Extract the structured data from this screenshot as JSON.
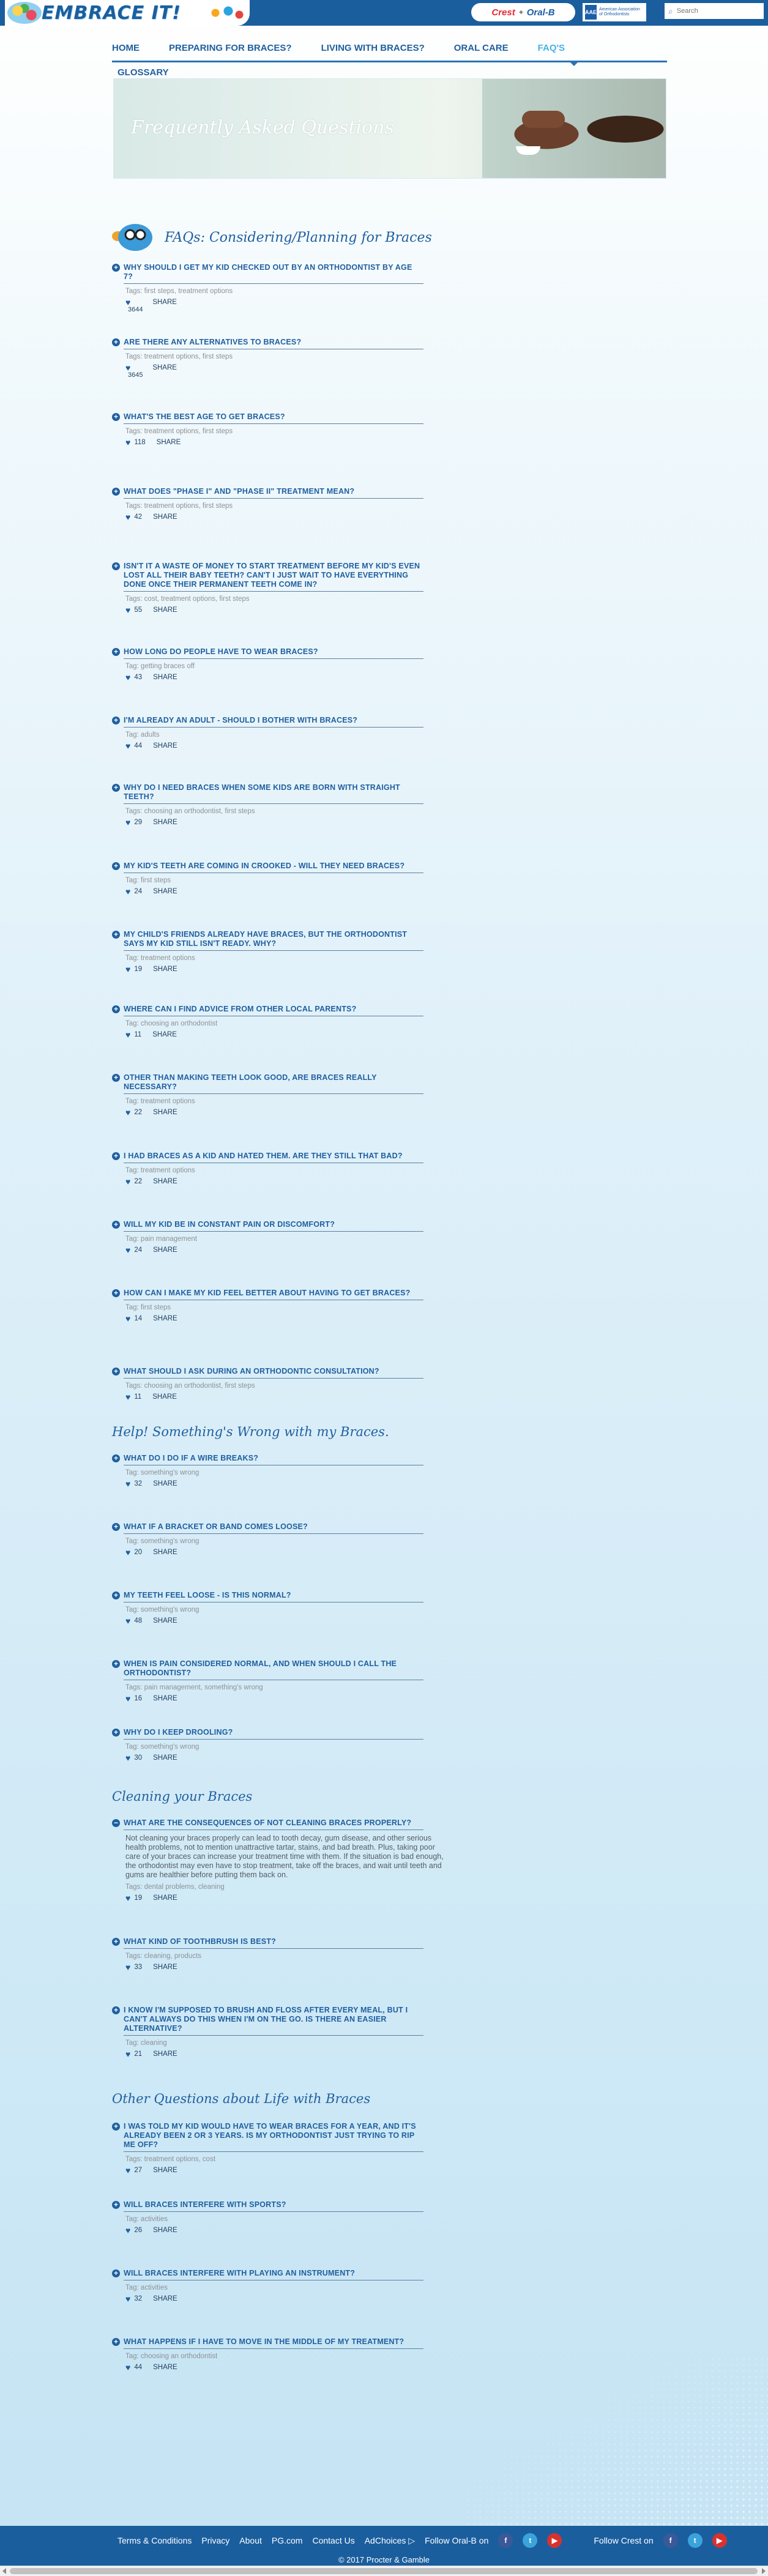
{
  "header": {
    "logo_text": "EMBRACE IT!",
    "brand_crest": "Crest",
    "brand_plus": "+",
    "brand_oralb": "Oral-B",
    "aae_mark": "AAE",
    "aae_text": "American Association of Orthodontists",
    "search_placeholder": "Search"
  },
  "nav": {
    "items": [
      "HOME",
      "PREPARING FOR BRACES?",
      "LIVING WITH BRACES?",
      "ORAL CARE",
      "FAQ'S"
    ],
    "active": "FAQ'S",
    "glossary": "GLOSSARY"
  },
  "banner": {
    "title": "Frequently Asked Questions"
  },
  "sections": [
    {
      "title": "FAQs: Considering/Planning for Braces",
      "faqs": [
        {
          "q": "Why should I get my kid checked out by an orthodontist by age 7?",
          "tags": "Tags: first steps, treatment options",
          "likes": "3644"
        },
        {
          "q": "Are there any alternatives to braces?",
          "tags": "Tags: treatment options, first steps",
          "likes": "3645"
        },
        {
          "q": "What's the best age to get braces?",
          "tags": "Tags: treatment options, first steps",
          "likes": "118"
        },
        {
          "q": "What does \"Phase I\" and \"Phase II\" treatment mean?",
          "tags": "Tags: treatment options, first steps",
          "likes": "42"
        },
        {
          "q": "Isn't it a waste of money to start treatment before my kid's even lost all their baby teeth? Can't I just wait to have everything done once their permanent teeth come in?",
          "tags": "Tags: cost, treatment options, first steps",
          "likes": "55"
        },
        {
          "q": "How long do people have to wear braces?",
          "tags": "Tag: getting braces off",
          "likes": "43"
        },
        {
          "q": "I'm already an adult - should I bother with braces?",
          "tags": "Tag: adults",
          "likes": "44"
        },
        {
          "q": "Why do I need braces when some kids are born with straight teeth?",
          "tags": "Tags: choosing an orthodontist, first steps",
          "likes": "29"
        },
        {
          "q": "My kid's teeth are coming in crooked - will they need braces?",
          "tags": "Tag: first steps",
          "likes": "24"
        },
        {
          "q": "My child's friends already have braces, but the orthodontist says my kid still isn't ready. Why?",
          "tags": "Tag: treatment options",
          "likes": "19"
        },
        {
          "q": "Where can I find advice from other local parents?",
          "tags": "Tag: choosing an orthodontist",
          "likes": "11"
        },
        {
          "q": "Other than making teeth look good, are braces really necessary?",
          "tags": "Tag: treatment options",
          "likes": "22"
        },
        {
          "q": "I had braces as a kid and hated them. Are they still that bad?",
          "tags": "Tag: treatment options",
          "likes": "22"
        },
        {
          "q": "Will my kid be in constant pain or discomfort?",
          "tags": "Tag: pain management",
          "likes": "24"
        },
        {
          "q": "How can I make my kid feel better about having to get braces?",
          "tags": "Tag: first steps",
          "likes": "14"
        },
        {
          "q": "What should I ask during an orthodontic consultation?",
          "tags": "Tags: choosing an orthodontist, first steps",
          "likes": "11"
        }
      ]
    },
    {
      "title": "Help! Something's Wrong with my Braces.",
      "faqs": [
        {
          "q": "What do I do if a wire breaks?",
          "tags": "Tag: something's wrong",
          "likes": "32"
        },
        {
          "q": "What if a bracket or band comes loose?",
          "tags": "Tag: something's wrong",
          "likes": "20"
        },
        {
          "q": "My teeth feel loose - is this normal?",
          "tags": "Tag: something's wrong",
          "likes": "48"
        },
        {
          "q": "When is pain considered normal, and when should I call the orthodontist?",
          "tags": "Tags: pain management, something's wrong",
          "likes": "16"
        },
        {
          "q": "Why do I keep drooling?",
          "tags": "Tag: something's wrong",
          "likes": "30"
        }
      ]
    },
    {
      "title": "Cleaning your Braces",
      "faqs": [
        {
          "q": "What are the consequences of not cleaning braces properly?",
          "body": "Not cleaning your braces properly can lead to tooth decay, gum disease, and other serious health problems, not to mention unattractive tartar, stains, and bad breath. Plus, taking poor care of your braces can increase your treatment time with them. If the situation is bad enough, the orthodontist may even have to stop treatment, take off the braces, and wait until teeth and gums are healthier before putting them back on.",
          "tags": "Tags: dental problems, cleaning",
          "likes": "19"
        },
        {
          "q": "What kind of toothbrush is best?",
          "tags": "Tags: cleaning, products",
          "likes": "33"
        },
        {
          "q": "I know I'm supposed to brush and floss after every meal, but I can't always do this when I'm on the go. Is there an easier alternative?",
          "tags": "Tag: cleaning",
          "likes": "21"
        }
      ]
    },
    {
      "title": "Other Questions about Life with Braces",
      "faqs": [
        {
          "q": "I was told my kid would have to wear braces for a year, and it's already been 2 or 3 years. Is my orthodontist just trying to rip me off?",
          "tags": "Tags: treatment options, cost",
          "likes": "27"
        },
        {
          "q": "Will braces interfere with sports?",
          "tags": "Tag: activities",
          "likes": "26"
        },
        {
          "q": "Will braces interfere with playing an instrument?",
          "tags": "Tag: activities",
          "likes": "32"
        },
        {
          "q": "What happens if I have to move in the middle of my treatment?",
          "tags": "Tag: choosing an orthodontist",
          "likes": "44"
        }
      ]
    }
  ],
  "share_label": "SHARE",
  "footer": {
    "links": [
      "Terms & Conditions",
      "Privacy",
      "About",
      "PG.com",
      "Contact Us",
      "AdChoices"
    ],
    "follow_oralb": "Follow Oral-B on",
    "follow_crest": "Follow Crest on",
    "copyright": "© 2017 Procter & Gamble"
  },
  "icons": [
    "search-icon",
    "plus-icon",
    "heart-icon",
    "facebook-icon",
    "twitter-icon",
    "youtube-icon",
    "adchoices-icon"
  ]
}
